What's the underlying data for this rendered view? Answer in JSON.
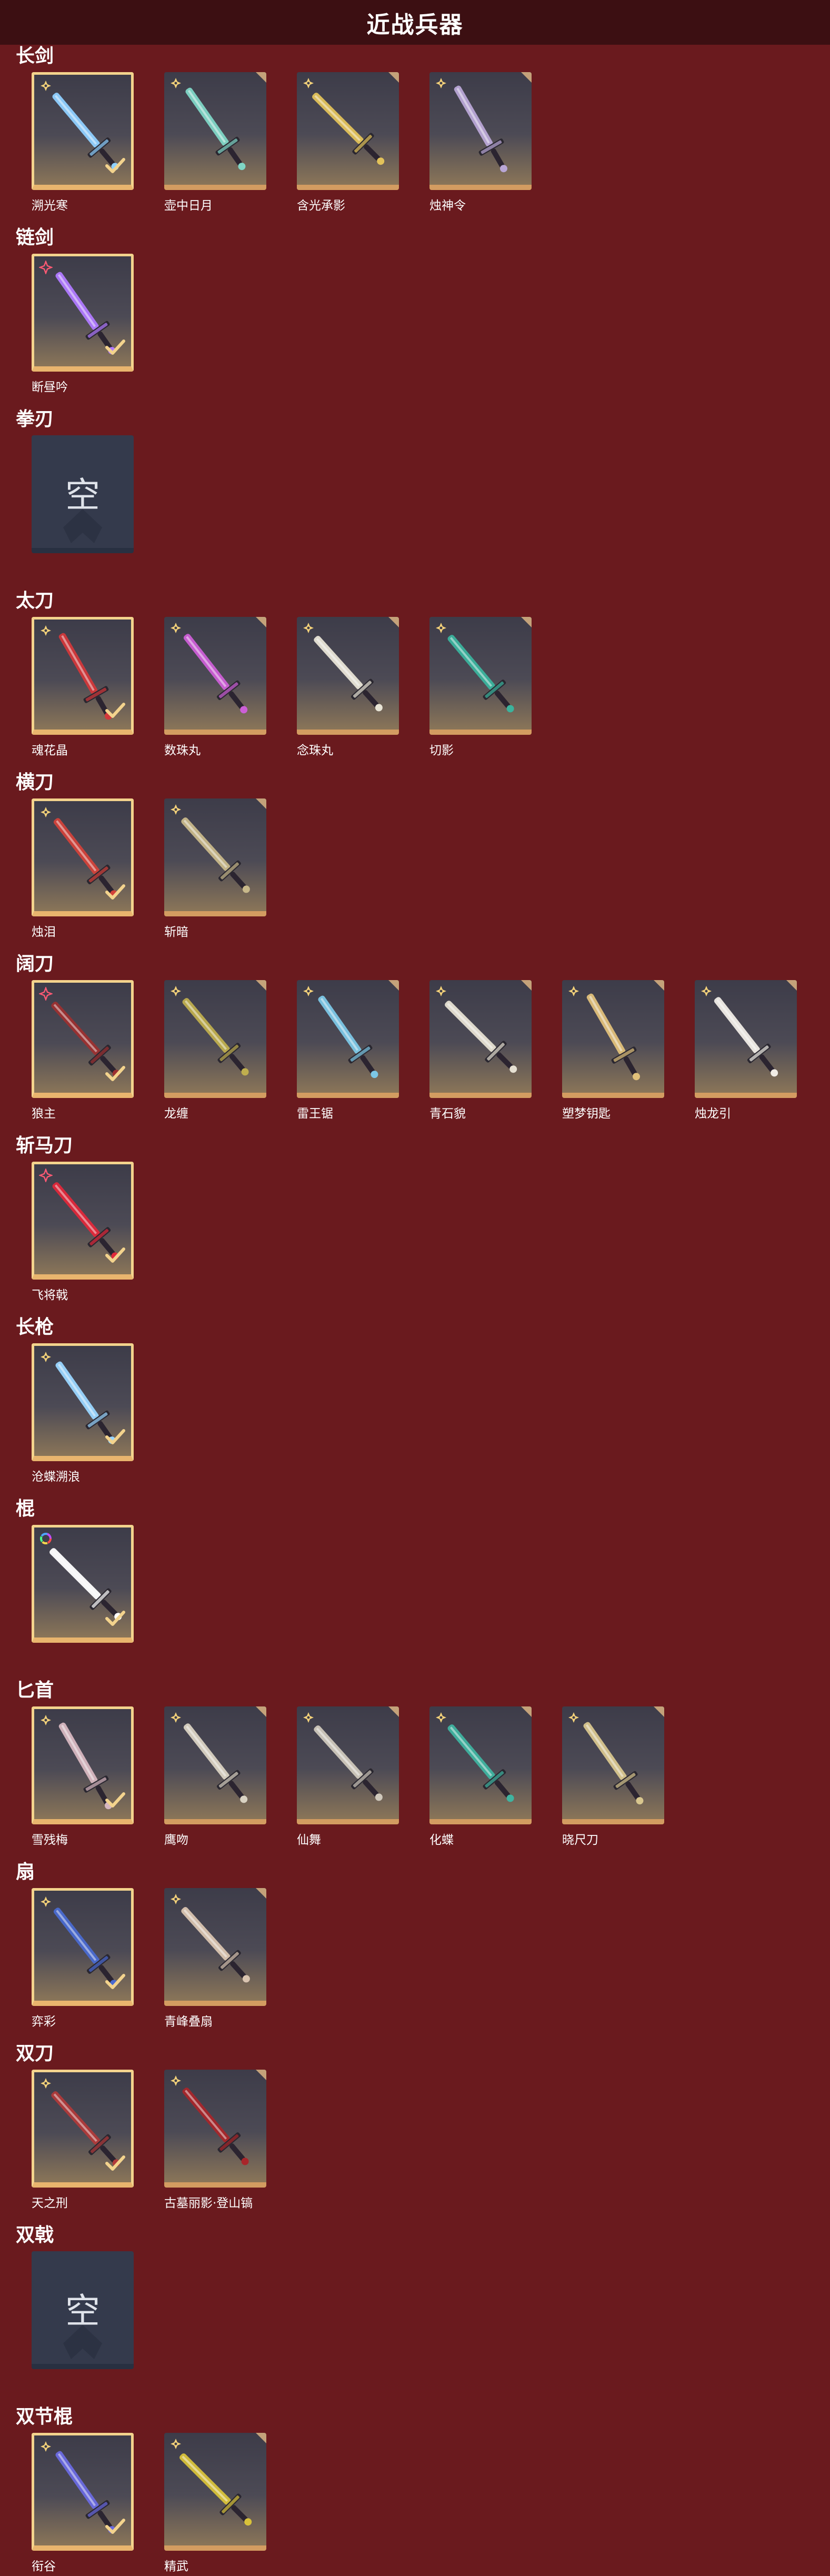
{
  "page_title": "近战兵器",
  "empty_label": "空",
  "sections": [
    {
      "title": "长剑",
      "items": [
        {
          "name": "溯光寒",
          "rarity": "gold",
          "owned": true,
          "accent": "#8fd0ff"
        },
        {
          "name": "壶中日月",
          "rarity": "gold",
          "owned": false,
          "accent": "#7fd6c6"
        },
        {
          "name": "含光承影",
          "rarity": "gold",
          "owned": false,
          "accent": "#e2c25a"
        },
        {
          "name": "烛神令",
          "rarity": "gold",
          "owned": false,
          "accent": "#b9a6d6"
        }
      ]
    },
    {
      "title": "链剑",
      "items": [
        {
          "name": "断昼吟",
          "rarity": "red",
          "owned": true,
          "accent": "#b07aff"
        }
      ]
    },
    {
      "title": "拳刃",
      "items": []
    },
    {
      "title": "太刀",
      "items": [
        {
          "name": "魂花晶",
          "rarity": "gold",
          "owned": true,
          "accent": "#d2383a"
        },
        {
          "name": "数珠丸",
          "rarity": "gold",
          "owned": false,
          "accent": "#cc5fd6"
        },
        {
          "name": "念珠丸",
          "rarity": "gold",
          "owned": false,
          "accent": "#e8e4d6"
        },
        {
          "name": "切影",
          "rarity": "gold",
          "owned": false,
          "accent": "#3bb39d"
        }
      ]
    },
    {
      "title": "横刀",
      "items": [
        {
          "name": "烛泪",
          "rarity": "gold",
          "owned": true,
          "accent": "#d2423a"
        },
        {
          "name": "斩暗",
          "rarity": "gold",
          "owned": false,
          "accent": "#c8b88a"
        }
      ]
    },
    {
      "title": "阔刀",
      "items": [
        {
          "name": "狼主",
          "rarity": "red",
          "owned": true,
          "accent": "#9c3030"
        },
        {
          "name": "龙缠",
          "rarity": "gold",
          "owned": false,
          "accent": "#bfae4e"
        },
        {
          "name": "雷王锯",
          "rarity": "gold",
          "owned": false,
          "accent": "#7cc7e6"
        },
        {
          "name": "青石貌",
          "rarity": "gold",
          "owned": false,
          "accent": "#e6e0d2"
        },
        {
          "name": "塑梦钥匙",
          "rarity": "gold",
          "owned": false,
          "accent": "#e0c07a"
        },
        {
          "name": "烛龙引",
          "rarity": "gold",
          "owned": false,
          "accent": "#f0ece6"
        }
      ]
    },
    {
      "title": "斩马刀",
      "items": [
        {
          "name": "飞将戟",
          "rarity": "red",
          "owned": true,
          "accent": "#e0283a"
        }
      ]
    },
    {
      "title": "长枪",
      "items": [
        {
          "name": "沧蝶溯浪",
          "rarity": "gold",
          "owned": true,
          "accent": "#9ad6ff"
        }
      ]
    },
    {
      "title": "棍",
      "items": [
        {
          "name": "",
          "rarity": "rainbow",
          "owned": true,
          "accent": "#ffffff"
        }
      ]
    },
    {
      "title": "匕首",
      "items": [
        {
          "name": "雪残梅",
          "rarity": "gold",
          "owned": true,
          "accent": "#d7b7c0"
        },
        {
          "name": "鹰吻",
          "rarity": "gold",
          "owned": false,
          "accent": "#d9d2c2"
        },
        {
          "name": "仙舞",
          "rarity": "gold",
          "owned": false,
          "accent": "#cfc8bc"
        },
        {
          "name": "化蝶",
          "rarity": "gold",
          "owned": false,
          "accent": "#3fb3a0"
        },
        {
          "name": "晓尺刀",
          "rarity": "gold",
          "owned": false,
          "accent": "#d8c68e"
        }
      ]
    },
    {
      "title": "扇",
      "items": [
        {
          "name": "弈彩",
          "rarity": "gold",
          "owned": true,
          "accent": "#4a6ad0"
        },
        {
          "name": "青峰叠扇",
          "rarity": "gold",
          "owned": false,
          "accent": "#d9c4b0"
        }
      ]
    },
    {
      "title": "双刀",
      "items": [
        {
          "name": "天之刑",
          "rarity": "gold",
          "owned": true,
          "accent": "#b03a3a"
        },
        {
          "name": "古墓丽影·登山镐",
          "rarity": "gold",
          "owned": false,
          "accent": "#a8262a"
        }
      ]
    },
    {
      "title": "双戟",
      "items": []
    },
    {
      "title": "双节棍",
      "items": [
        {
          "name": "衔谷",
          "rarity": "gold",
          "owned": true,
          "accent": "#6a6ae0"
        },
        {
          "name": "精武",
          "rarity": "gold",
          "owned": false,
          "accent": "#d8c23a"
        }
      ]
    }
  ]
}
